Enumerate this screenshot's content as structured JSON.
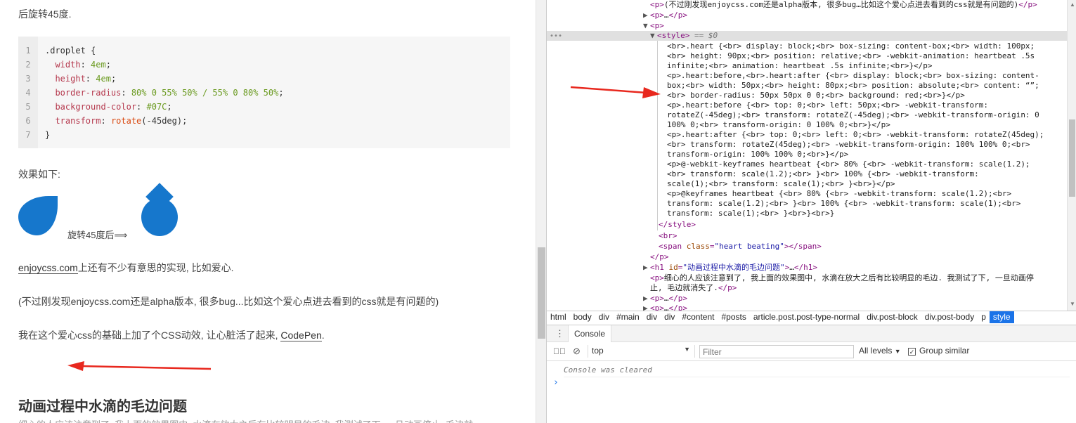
{
  "article": {
    "intro_tail": "后旋转45度.",
    "code_lines": [
      {
        "n": "1",
        "parts": [
          {
            "t": ".droplet {",
            "c": ""
          }
        ]
      },
      {
        "n": "2",
        "parts": [
          {
            "t": "  width",
            "c": "prop"
          },
          {
            "t": ": ",
            "c": ""
          },
          {
            "t": "4em",
            "c": "val"
          },
          {
            "t": ";",
            "c": ""
          }
        ]
      },
      {
        "n": "3",
        "parts": [
          {
            "t": "  height",
            "c": "prop"
          },
          {
            "t": ": ",
            "c": ""
          },
          {
            "t": "4em",
            "c": "val"
          },
          {
            "t": ";",
            "c": ""
          }
        ]
      },
      {
        "n": "4",
        "parts": [
          {
            "t": "  border-radius",
            "c": "prop"
          },
          {
            "t": ": ",
            "c": ""
          },
          {
            "t": "80% 0 55% 50% / 55% 0 80% 50%",
            "c": "val"
          },
          {
            "t": ";",
            "c": ""
          }
        ]
      },
      {
        "n": "5",
        "parts": [
          {
            "t": "  background-color",
            "c": "prop"
          },
          {
            "t": ": ",
            "c": ""
          },
          {
            "t": "#07C",
            "c": "val"
          },
          {
            "t": ";",
            "c": ""
          }
        ]
      },
      {
        "n": "6",
        "parts": [
          {
            "t": "  transform",
            "c": "prop"
          },
          {
            "t": ": ",
            "c": ""
          },
          {
            "t": "rotate",
            "c": "fn"
          },
          {
            "t": "(-45deg);",
            "c": ""
          }
        ]
      },
      {
        "n": "7",
        "parts": [
          {
            "t": "}",
            "c": ""
          }
        ]
      }
    ],
    "effect_label": "效果如下:",
    "rotate_caption": "旋转45度后⟹",
    "enjoy_link": "enjoycss.com",
    "enjoy_rest": "上还有不少有意思的实现, 比如爱心.",
    "note": "(不过刚发现enjoycss.com还是alpha版本, 很多bug...比如这个爱心点进去看到的css就是有问题的)",
    "anim_text": "我在这个爱心css的基础上加了个CSS动效, 让心脏活了起来,",
    "codepen_link": "CodePen",
    "anim_end": ".",
    "heading": "动画过程中水滴的毛边问题",
    "trailing": "细心的人应该注意到了, 我上面的效果图中, 水滴在放大之后有比较明显的毛边. 我测试了下, 一旦动画停止, 毛边就"
  },
  "colors": {
    "droplet": "#1677CC",
    "arrow": "#E8281E",
    "active_crumb": "#1A73E8"
  },
  "devtools": {
    "rows": {
      "r0_text": "(不过刚发现enjoycss.com还是alpha版本, 很多bug…比如这个爱心点进去看到的css就是有问题的)",
      "r1": "…",
      "style_eq": "== $0",
      "css_lines": [
        "<br>.heart {<br>  display: block;<br>  box-sizing: content-box;<br>  width: 100px;",
        "<br>  height: 90px;<br>  position: relative;<br>  -webkit-animation: heartbeat .5s",
        "infinite;<br>          animation: heartbeat .5s infinite;<br>}</p>",
        "<p>.heart:before,<br>.heart:after {<br>  display: block;<br>  box-sizing: content-",
        "box;<br>  width: 50px;<br>  height: 80px;<br>  position: absolute;<br>  content: “”;",
        "<br>  border-radius: 50px 50px 0 0;<br>  background: red;<br>}</p>",
        "<p>.heart:before {<br>  top: 0;<br>  left: 50px;<br>  -webkit-transform:",
        "rotateZ(-45deg);<br>  transform: rotateZ(-45deg);<br>  -webkit-transform-origin: 0",
        "100% 0;<br>  transform-origin: 0 100% 0;<br>}</p>",
        "<p>.heart:after {<br>  top: 0;<br>  left: 0;<br>  -webkit-transform: rotateZ(45deg);",
        "<br>  transform: rotateZ(45deg);<br>  -webkit-transform-origin: 100% 100% 0;<br>",
        "transform-origin: 100% 100% 0;<br>}</p>",
        "<p>@-webkit-keyframes heartbeat {<br>  80% {<br>    -webkit-transform: scale(1.2);",
        "<br>            transform: scale(1.2);<br>  }<br>  100% {<br>    -webkit-transform:",
        "scale(1);<br>            transform: scale(1);<br>  }<br>}</p>",
        "<p>@keyframes heartbeat {<br>  80% {<br>    -webkit-transform: scale(1.2);<br>",
        "transform: scale(1.2);<br>  }<br>  100% {<br>    -webkit-transform: scale(1);<br>",
        "transform: scale(1);<br>  }<br>}<br>}"
      ],
      "span_class_value": "heart beating",
      "h1_id_value": "动画过程中水滴的毛边问题",
      "p_text": "细心的人应该注意到了, 我上面的效果图中, 水滴在放大之后有比较明显的毛边. 我测试了下, 一旦动画停",
      "p_text2": "止, 毛边就消失了."
    },
    "breadcrumbs": [
      "html",
      "body",
      "div",
      "#main",
      "div",
      "div",
      "#content",
      "#posts",
      "article.post.post-type-normal",
      "div.post-block",
      "div.post-body",
      "p",
      "style"
    ],
    "drawer_tab": "Console",
    "context": "top",
    "filter_placeholder": "Filter",
    "levels": "All levels",
    "group_similar": "Group similar",
    "cleared": "Console was cleared"
  }
}
